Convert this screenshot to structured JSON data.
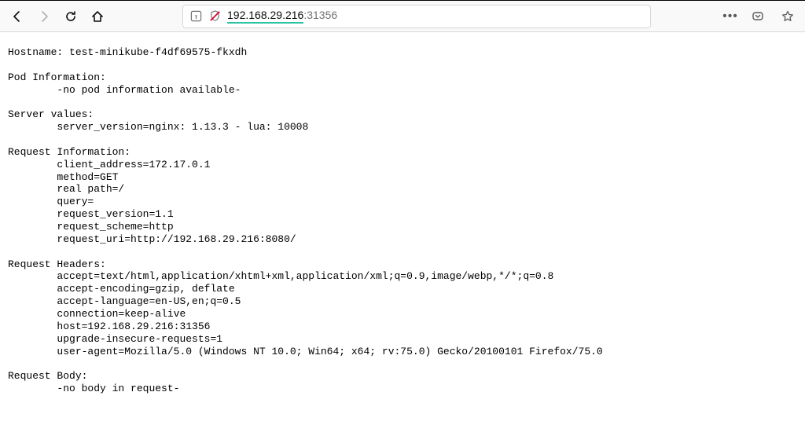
{
  "addressbar": {
    "host": "192.168.29.216",
    "port": ":31356"
  },
  "content": {
    "hostname_label": "Hostname: ",
    "hostname": "test-minikube-f4df69575-fkxdh",
    "pod_header": "Pod Information:",
    "pod_line": "-no pod information available-",
    "sv_header": "Server values:",
    "sv_line": "server_version=nginx: 1.13.3 - lua: 10008",
    "ri_header": "Request Information:",
    "ri_client": "client_address=172.17.0.1",
    "ri_method": "method=GET",
    "ri_realpath": "real path=/",
    "ri_query": "query=",
    "ri_reqver": "request_version=1.1",
    "ri_scheme": "request_scheme=http",
    "ri_uri": "request_uri=http://192.168.29.216:8080/",
    "rh_header": "Request Headers:",
    "rh_accept": "accept=text/html,application/xhtml+xml,application/xml;q=0.9,image/webp,*/*;q=0.8",
    "rh_ae": "accept-encoding=gzip, deflate",
    "rh_al": "accept-language=en-US,en;q=0.5",
    "rh_conn": "connection=keep-alive",
    "rh_host": "host=192.168.29.216:31356",
    "rh_uir": "upgrade-insecure-requests=1",
    "rh_ua": "user-agent=Mozilla/5.0 (Windows NT 10.0; Win64; x64; rv:75.0) Gecko/20100101 Firefox/75.0",
    "rb_header": "Request Body:",
    "rb_line": "-no body in request-"
  }
}
